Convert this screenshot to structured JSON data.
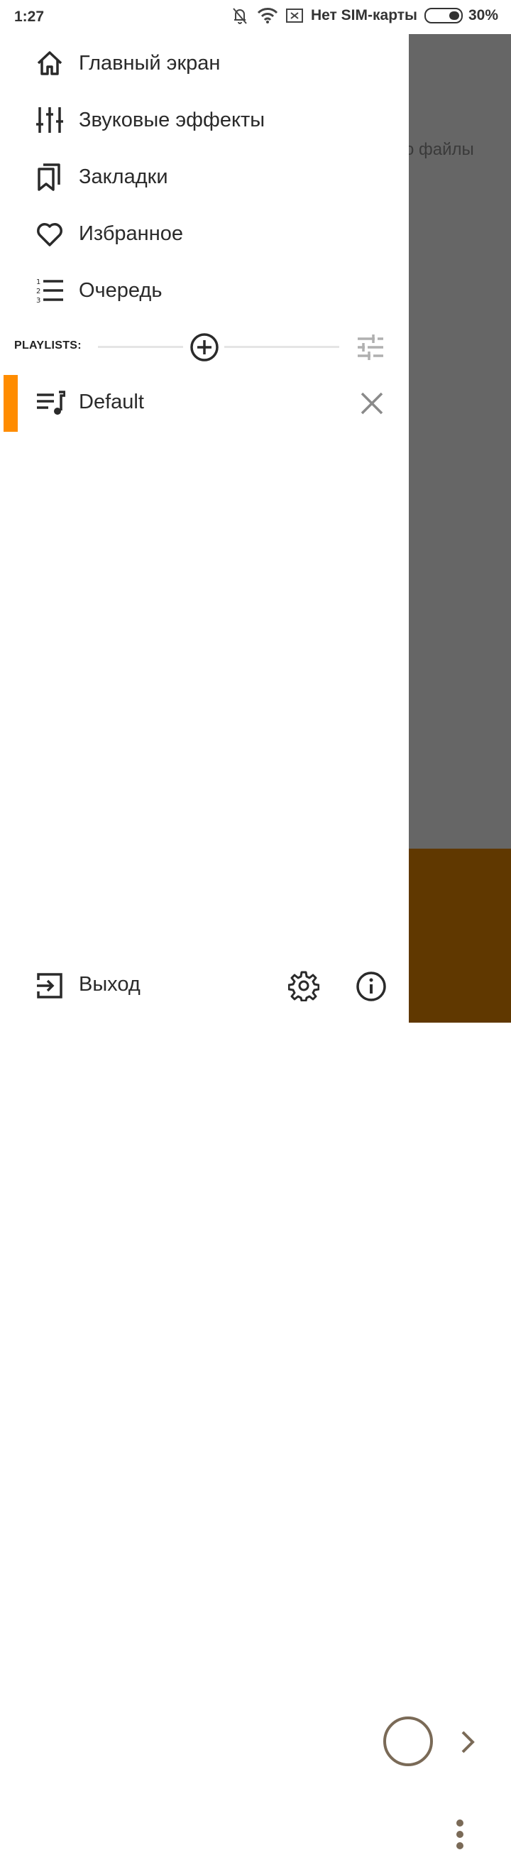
{
  "status_bar": {
    "time": "1:27",
    "sim_status": "Нет SIM-карты",
    "battery": "30%"
  },
  "background": {
    "partial_text": "о файлы",
    "player_color": "#603800",
    "overlay_color": "#666666"
  },
  "drawer": {
    "nav_items": [
      {
        "label": "Главный экран",
        "icon": "home-icon"
      },
      {
        "label": "Звуковые эффекты",
        "icon": "equalizer-icon"
      },
      {
        "label": "Закладки",
        "icon": "bookmarks-icon"
      },
      {
        "label": "Избранное",
        "icon": "heart-icon"
      },
      {
        "label": "Очередь",
        "icon": "numbered-list-icon"
      }
    ],
    "playlists_label": "PLAYLISTS:",
    "playlists": [
      {
        "label": "Default",
        "active": true
      }
    ],
    "footer": {
      "exit_label": "Выход"
    },
    "accent_color": "#ff8c00"
  }
}
